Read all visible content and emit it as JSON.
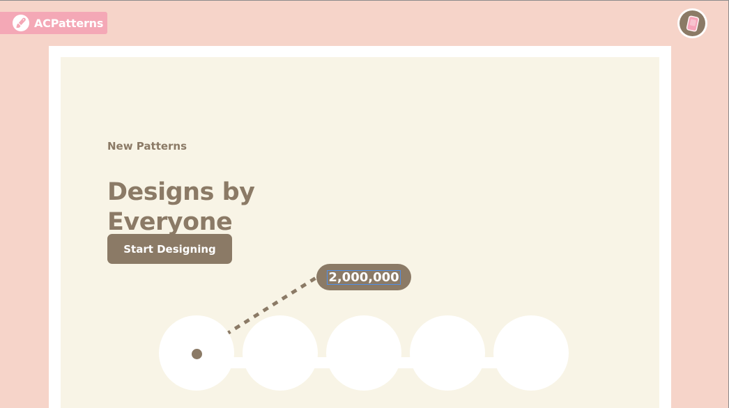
{
  "brand": {
    "name": "ACPatterns",
    "logo_icon": "paintbrush-icon"
  },
  "header": {
    "profile_icon": "pink-card-avatar-icon"
  },
  "hero": {
    "eyebrow": "New Patterns",
    "headline": "Designs by Everyone",
    "cta_label": "Start Designing",
    "count": "2,000,000"
  },
  "colors": {
    "page_background": "#f6d4c9",
    "panel_background": "#f8f4e6",
    "accent_brown": "#8b7a66",
    "brand_pink": "#f4a8b6",
    "white": "#ffffff"
  },
  "pattern_slots": [
    {
      "name": "pattern-slot-1",
      "active": true
    },
    {
      "name": "pattern-slot-2",
      "active": false
    },
    {
      "name": "pattern-slot-3",
      "active": false
    },
    {
      "name": "pattern-slot-4",
      "active": false
    },
    {
      "name": "pattern-slot-5",
      "active": false
    }
  ]
}
